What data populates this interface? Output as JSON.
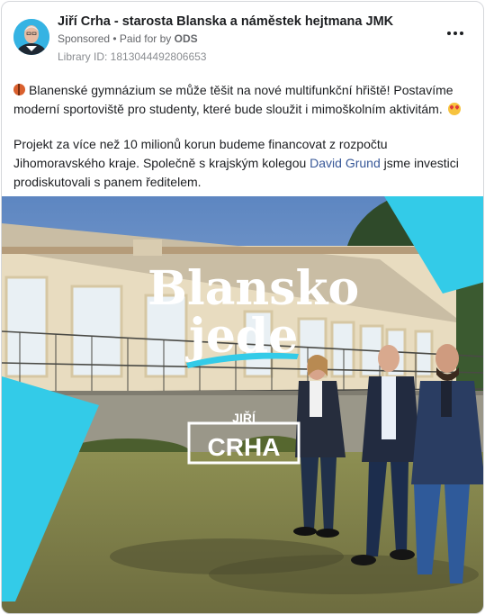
{
  "post": {
    "page_name": "Jiří Crha - starosta Blanska a náměstek hejtmana JMK",
    "sponsored_label": "Sponsored",
    "separator": " • ",
    "paid_for_prefix": "Paid for by ",
    "paid_for_by": "ODS",
    "library_id": "Library ID: 1813044492806653",
    "paragraph1": "Blanenské gymnázium se může těšit na nové multifunkční hřiště! Postavíme moderní sportoviště pro studenty, které bude sloužit i mimoškolním aktivitám.",
    "paragraph2_before": "Projekt za více než 10 milionů korun budeme financovat z rozpočtu Jihomoravského kraje. Společně s krajským kolegou ",
    "paragraph2_link": "David Grund",
    "paragraph2_after": " jsme investici prodiskutovali s panem ředitelem."
  },
  "image": {
    "slogan_line1": "Blansko",
    "slogan_line2": "jede",
    "name_first": "JIŘÍ",
    "name_last": "CRHA"
  },
  "icons": {
    "avatar": "profile-photo",
    "more": "more-options-icon",
    "emoji1": "basketball-emoji",
    "emoji2": "heart-eyes-emoji"
  },
  "colors": {
    "accent_cyan": "#33cbe8",
    "link": "#385898"
  }
}
